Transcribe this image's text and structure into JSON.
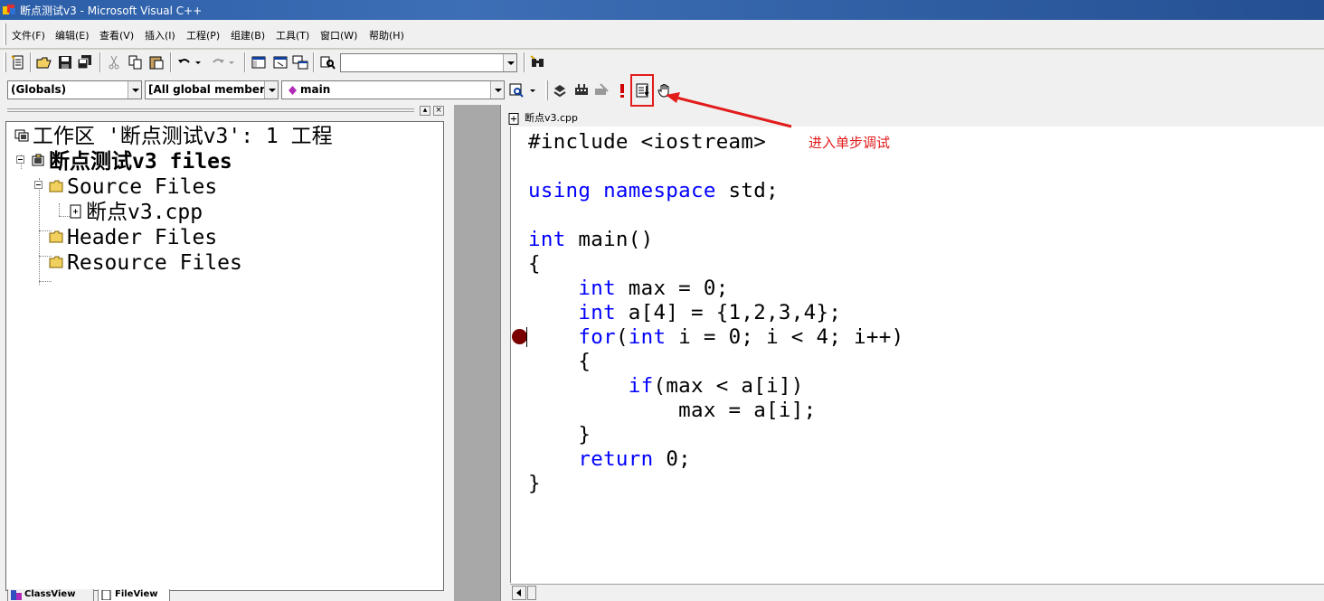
{
  "window": {
    "title": "断点测试v3 - Microsoft Visual C++"
  },
  "menu": [
    {
      "label": "文件(F)"
    },
    {
      "label": "编辑(E)"
    },
    {
      "label": "查看(V)"
    },
    {
      "label": "插入(I)"
    },
    {
      "label": "工程(P)"
    },
    {
      "label": "组建(B)"
    },
    {
      "label": "工具(T)"
    },
    {
      "label": "窗口(W)"
    },
    {
      "label": "帮助(H)"
    }
  ],
  "toolbar": {
    "find_combo_value": "",
    "wizard": {
      "class_combo": "(Globals)",
      "filter_combo": "[All global members",
      "members_combo": "main"
    }
  },
  "workspace": {
    "tree": [
      {
        "label": "工作区 '断点测试v3': 1 工程",
        "icon": "workspace-icon"
      },
      {
        "label": "断点测试v3 files",
        "icon": "project-icon"
      },
      {
        "label": "Source Files",
        "icon": "folder-icon"
      },
      {
        "label": "断点v3.cpp",
        "icon": "cpp-file-icon"
      },
      {
        "label": "Header Files",
        "icon": "folder-icon"
      },
      {
        "label": "Resource Files",
        "icon": "folder-icon"
      }
    ],
    "tabs": [
      {
        "label": "ClassView"
      },
      {
        "label": "FileView"
      }
    ]
  },
  "editor": {
    "tab_title": "断点v3.cpp",
    "breakpoint_line": 9,
    "lines": [
      [
        {
          "t": "#include <iostream>",
          "k": 0
        }
      ],
      [
        {
          "t": "",
          "k": 0
        }
      ],
      [
        {
          "t": "using namespace",
          "k": 1
        },
        {
          "t": " std;",
          "k": 0
        }
      ],
      [
        {
          "t": "",
          "k": 0
        }
      ],
      [
        {
          "t": "int",
          "k": 1
        },
        {
          "t": " main()",
          "k": 0
        }
      ],
      [
        {
          "t": "{",
          "k": 0
        }
      ],
      [
        {
          "t": "    ",
          "k": 0
        },
        {
          "t": "int",
          "k": 1
        },
        {
          "t": " max = 0;",
          "k": 0
        }
      ],
      [
        {
          "t": "    ",
          "k": 0
        },
        {
          "t": "int",
          "k": 1
        },
        {
          "t": " a[4] = {1,2,3,4};",
          "k": 0
        }
      ],
      [
        {
          "t": "    ",
          "k": 0
        },
        {
          "t": "for",
          "k": 1
        },
        {
          "t": "(",
          "k": 0
        },
        {
          "t": "int",
          "k": 1
        },
        {
          "t": " i = 0; i < 4; i++)",
          "k": 0
        }
      ],
      [
        {
          "t": "    {",
          "k": 0
        }
      ],
      [
        {
          "t": "        ",
          "k": 0
        },
        {
          "t": "if",
          "k": 1
        },
        {
          "t": "(max < a[i])",
          "k": 0
        }
      ],
      [
        {
          "t": "            max = a[i];",
          "k": 0
        }
      ],
      [
        {
          "t": "    }",
          "k": 0
        }
      ],
      [
        {
          "t": "    ",
          "k": 0
        },
        {
          "t": "return",
          "k": 1
        },
        {
          "t": " 0;",
          "k": 0
        }
      ],
      [
        {
          "t": "}",
          "k": 0
        }
      ]
    ]
  },
  "annotation": {
    "text": "进入单步调试",
    "color": "#e21b1b"
  }
}
